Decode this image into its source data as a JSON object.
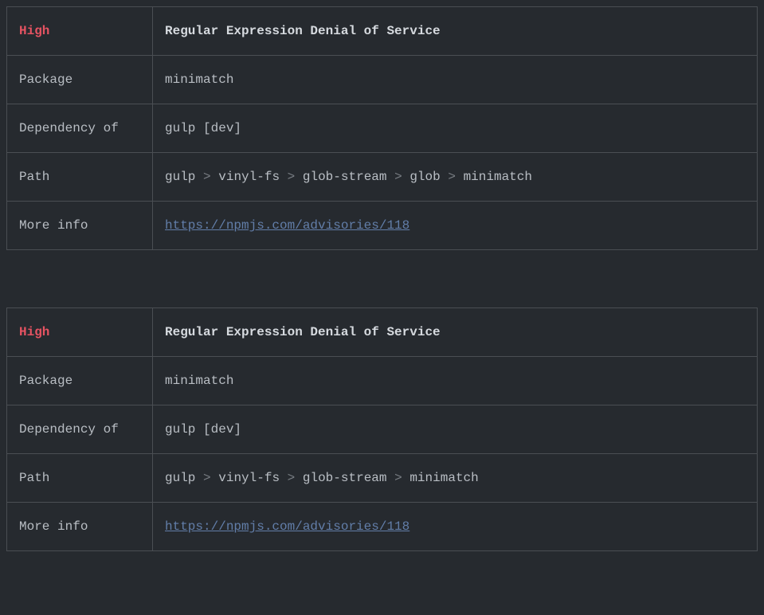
{
  "labels": {
    "package": "Package",
    "dependencyOf": "Dependency of",
    "path": "Path",
    "moreInfo": "More info"
  },
  "pathSeparator": ">",
  "advisories": [
    {
      "severity": "High",
      "title": "Regular Expression Denial of Service",
      "package": "minimatch",
      "dependencyOf": "gulp [dev]",
      "pathSegments": [
        "gulp",
        "vinyl-fs",
        "glob-stream",
        "glob",
        "minimatch"
      ],
      "moreInfoUrl": "https://npmjs.com/advisories/118"
    },
    {
      "severity": "High",
      "title": "Regular Expression Denial of Service",
      "package": "minimatch",
      "dependencyOf": "gulp [dev]",
      "pathSegments": [
        "gulp",
        "vinyl-fs",
        "glob-stream",
        "minimatch"
      ],
      "moreInfoUrl": "https://npmjs.com/advisories/118"
    }
  ]
}
